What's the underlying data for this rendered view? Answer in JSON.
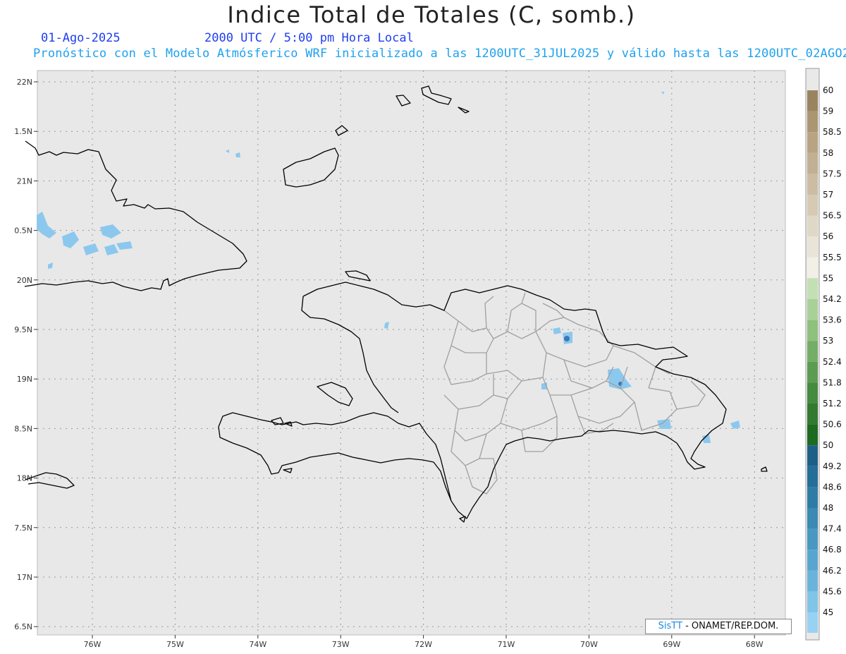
{
  "header": {
    "title": "Indice Total de Totales (C, somb.)",
    "date": "01-Ago-2025",
    "time": "2000 UTC / 5:00 pm Hora Local",
    "description": "Pronóstico con el Modelo Atmósferico WRF inicializado a las 1200UTC_31JUL2025 y válido hasta las  1200UTC_02AGO2025"
  },
  "map": {
    "region": "Hispaniola",
    "lat_labels": [
      "22N",
      "1.5N",
      "21N",
      "0.5N",
      "20N",
      "9.5N",
      "19N",
      "8.5N",
      "18N",
      "7.5N",
      "17N",
      "6.5N"
    ],
    "lon_labels": [
      "76W",
      "75W",
      "74W",
      "73W",
      "72W",
      "71W",
      "70W",
      "69W",
      "68W"
    ],
    "background_color": "#e8e8e8",
    "coastline_color": "#000000",
    "province_border_color": "#a0a0a0",
    "shading_color": "#8cc8ee"
  },
  "colorbar": {
    "labels": [
      "60",
      "59",
      "58.5",
      "58",
      "57.5",
      "57",
      "56.5",
      "56",
      "55.5",
      "55",
      "54.2",
      "53.6",
      "53",
      "52.4",
      "51.8",
      "51.2",
      "50.6",
      "50",
      "49.2",
      "48.6",
      "48",
      "47.4",
      "46.8",
      "46.2",
      "45.6",
      "45"
    ],
    "colors": [
      "#9a8460",
      "#ac9672",
      "#b8a482",
      "#c2b092",
      "#ccbca2",
      "#d6cab4",
      "#e0d8c6",
      "#e9e4d8",
      "#f2efe6",
      "#c2e0b4",
      "#a8d198",
      "#8ec07e",
      "#74ae66",
      "#5c9c52",
      "#468a40",
      "#327a30",
      "#1e6a20",
      "#1e5f88",
      "#246e98",
      "#2e7ca6",
      "#3a8ab4",
      "#4898c2",
      "#58a6d0",
      "#6ab4dc",
      "#80c4e8",
      "#98d2f2"
    ]
  },
  "footer": {
    "brand": "SisTT",
    "credit": "- ONAMET/REP.DOM."
  }
}
